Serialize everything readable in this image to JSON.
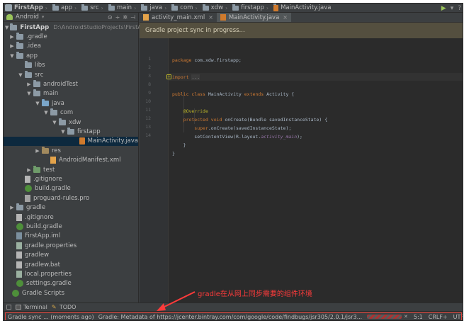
{
  "navbar": {
    "crumbs": [
      "FirstApp",
      "app",
      "src",
      "main",
      "java",
      "com",
      "xdw",
      "firstapp",
      "MainActivity.java"
    ]
  },
  "project_panel": {
    "view_label": "Android",
    "tree": [
      {
        "label": "FirstApp",
        "path": "D:\\AndroidStudioProjects\\FirstApp",
        "icon": "folder",
        "arrow": "▼"
      },
      {
        "label": ".gradle",
        "icon": "folder",
        "arrow": "▶"
      },
      {
        "label": ".idea",
        "icon": "folder",
        "arrow": "▶"
      },
      {
        "label": "app",
        "icon": "folder",
        "arrow": "▼"
      },
      {
        "label": "libs",
        "icon": "folder",
        "arrow": ""
      },
      {
        "label": "src",
        "icon": "folder",
        "arrow": "▼"
      },
      {
        "label": "androidTest",
        "icon": "folder",
        "arrow": "▶"
      },
      {
        "label": "main",
        "icon": "folder",
        "arrow": "▼"
      },
      {
        "label": "java",
        "icon": "folder-src",
        "arrow": "▼"
      },
      {
        "label": "com",
        "icon": "folder",
        "arrow": "▼"
      },
      {
        "label": "xdw",
        "icon": "folder",
        "arrow": "▼"
      },
      {
        "label": "firstapp",
        "icon": "folder",
        "arrow": "▼"
      },
      {
        "label": "MainActivity.java",
        "icon": "java",
        "arrow": ""
      },
      {
        "label": "res",
        "icon": "folder-res",
        "arrow": "▶"
      },
      {
        "label": "AndroidManifest.xml",
        "icon": "xml",
        "arrow": ""
      },
      {
        "label": "test",
        "icon": "folder-test",
        "arrow": "▶"
      },
      {
        "label": ".gitignore",
        "icon": "plain",
        "arrow": ""
      },
      {
        "label": "build.gradle",
        "icon": "gradle",
        "arrow": ""
      },
      {
        "label": "proguard-rules.pro",
        "icon": "pro",
        "arrow": ""
      },
      {
        "label": "gradle",
        "icon": "folder",
        "arrow": "▶"
      },
      {
        "label": ".gitignore",
        "icon": "plain",
        "arrow": ""
      },
      {
        "label": "build.gradle",
        "icon": "gradle",
        "arrow": ""
      },
      {
        "label": "FirstApp.iml",
        "icon": "iml",
        "arrow": ""
      },
      {
        "label": "gradle.properties",
        "icon": "properties",
        "arrow": ""
      },
      {
        "label": "gradlew",
        "icon": "plain",
        "arrow": ""
      },
      {
        "label": "gradlew.bat",
        "icon": "plain",
        "arrow": ""
      },
      {
        "label": "local.properties",
        "icon": "properties",
        "arrow": ""
      },
      {
        "label": "settings.gradle",
        "icon": "gradle",
        "arrow": ""
      },
      {
        "label": "Gradle Scripts",
        "icon": "gradle",
        "arrow": ""
      }
    ],
    "selected_index": 12
  },
  "editor": {
    "tabs": [
      {
        "label": "activity_main.xml",
        "active": false
      },
      {
        "label": "MainActivity.java",
        "active": true
      }
    ],
    "banner": "Gradle project sync in progress...",
    "line_numbers": [
      "1",
      "2",
      "3",
      "8",
      "9",
      "10",
      "11",
      "12",
      "13",
      "14"
    ],
    "code": [
      {
        "parts": [
          {
            "t": "package ",
            "c": "kw"
          },
          {
            "t": "com.xdw.firstapp;",
            "c": ""
          }
        ]
      },
      {
        "parts": []
      },
      {
        "parts": [
          {
            "t": "import ",
            "c": "kw"
          },
          {
            "t": "...",
            "c": "fold"
          }
        ]
      },
      {
        "parts": []
      },
      {
        "parts": [
          {
            "t": "public class ",
            "c": "kw"
          },
          {
            "t": "MainActivity ",
            "c": ""
          },
          {
            "t": "extends ",
            "c": "kw"
          },
          {
            "t": "Activity {",
            "c": ""
          }
        ]
      },
      {
        "parts": []
      },
      {
        "parts": [
          {
            "t": "    @Override",
            "c": "ann"
          }
        ]
      },
      {
        "parts": [
          {
            "t": "    protected void ",
            "c": "kw"
          },
          {
            "t": "onCreate(Bundle savedInstanceState) {",
            "c": ""
          }
        ]
      },
      {
        "parts": [
          {
            "t": "        super",
            "c": "kw"
          },
          {
            "t": ".onCreate(savedInstanceState);",
            "c": ""
          }
        ]
      },
      {
        "parts": [
          {
            "t": "        setContentView(R.layout.",
            "c": ""
          },
          {
            "t": "activity_main",
            "c": "italic"
          },
          {
            "t": ");",
            "c": ""
          }
        ]
      },
      {
        "parts": [
          {
            "t": "    }",
            "c": ""
          }
        ]
      },
      {
        "parts": [
          {
            "t": "}",
            "c": ""
          }
        ]
      }
    ]
  },
  "annotation": "gradle在从网上同步需要的组件环境",
  "toolwindows": [
    {
      "label": "Terminal",
      "icon": "terminal-icon"
    },
    {
      "label": "TODO",
      "icon": "todo-icon"
    }
  ],
  "statusbar": {
    "sync_label": "Gradle sync ... (moments ago)",
    "message": "Gradle: Metadata of https://jcenter.bintray.com/com/google/code/findbugs/jsr305/2.0.1/jsr3...",
    "position": "5:1",
    "line_ending": "CRLF÷",
    "encoding": "UTF"
  },
  "colors": {
    "ide_background": "#3c3f41",
    "editor_background": "#2b2b2b",
    "selection": "#0d293e",
    "annotation_red": "#ff3b3b",
    "banner": "#544f3f"
  }
}
